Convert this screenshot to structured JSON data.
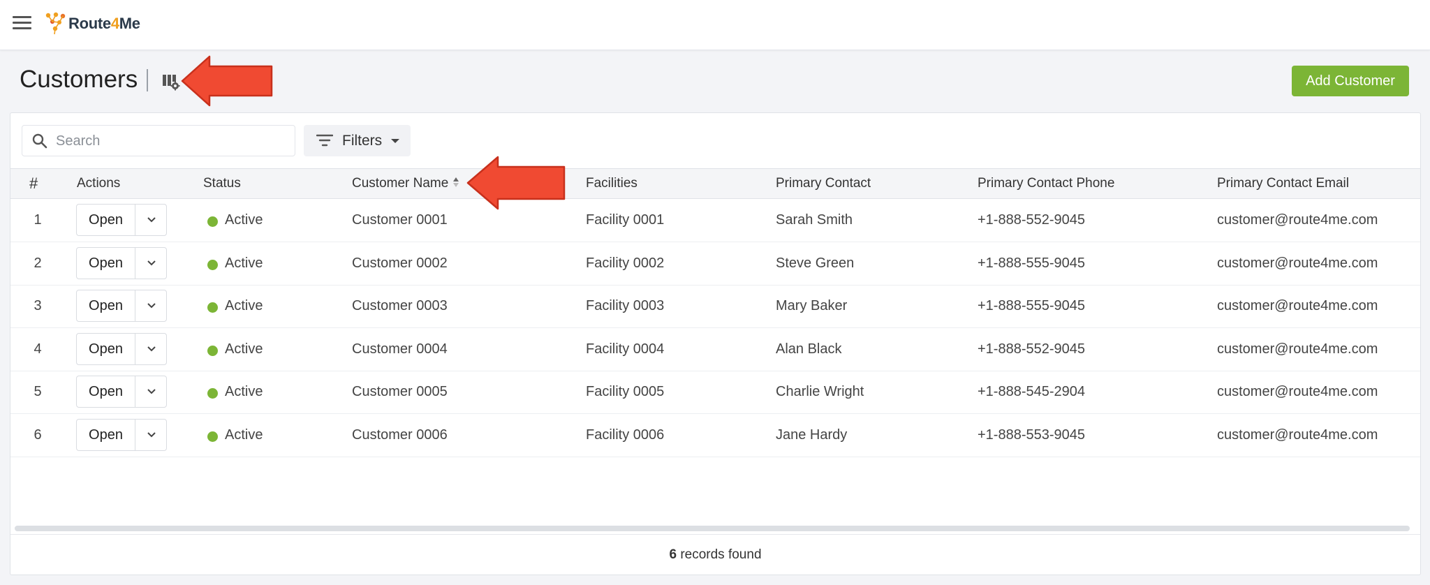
{
  "app": {
    "logo_prefix": "Route",
    "logo_four": "4",
    "logo_suffix": "Me"
  },
  "page": {
    "title": "Customers",
    "add_button": "Add Customer"
  },
  "toolbar": {
    "search_placeholder": "Search",
    "filters_label": "Filters"
  },
  "table": {
    "columns": [
      "#",
      "Actions",
      "Status",
      "Customer Name",
      "Facilities",
      "Primary Contact",
      "Primary Contact Phone",
      "Primary Contact Email"
    ],
    "rows": [
      {
        "num": "1",
        "action": "Open",
        "status": "Active",
        "name": "Customer 0001",
        "facility": "Facility 0001",
        "contact": "Sarah Smith",
        "phone": "+1-888-552-9045",
        "email": "customer@route4me.com"
      },
      {
        "num": "2",
        "action": "Open",
        "status": "Active",
        "name": "Customer 0002",
        "facility": "Facility 0002",
        "contact": "Steve Green",
        "phone": "+1-888-555-9045",
        "email": "customer@route4me.com"
      },
      {
        "num": "3",
        "action": "Open",
        "status": "Active",
        "name": "Customer 0003",
        "facility": "Facility 0003",
        "contact": "Mary Baker",
        "phone": "+1-888-555-9045",
        "email": "customer@route4me.com"
      },
      {
        "num": "4",
        "action": "Open",
        "status": "Active",
        "name": "Customer 0004",
        "facility": "Facility 0004",
        "contact": "Alan Black",
        "phone": "+1-888-552-9045",
        "email": "customer@route4me.com"
      },
      {
        "num": "5",
        "action": "Open",
        "status": "Active",
        "name": "Customer 0005",
        "facility": "Facility 0005",
        "contact": "Charlie Wright",
        "phone": "+1-888-545-2904",
        "email": "customer@route4me.com"
      },
      {
        "num": "6",
        "action": "Open",
        "status": "Active",
        "name": "Customer 0006",
        "facility": "Facility 0006",
        "contact": "Jane Hardy",
        "phone": "+1-888-553-9045",
        "email": "customer@route4me.com"
      }
    ]
  },
  "footer": {
    "count": "6",
    "suffix": " records found"
  },
  "icons": {
    "menu": "hamburger-icon",
    "logo": "route4me-logo-icon",
    "column_settings": "column-settings-icon",
    "search": "search-icon",
    "filter": "filter-icon",
    "sort": "sort-icon",
    "dropdown": "chevron-down-icon",
    "annotation": "red-arrow-icon"
  },
  "colors": {
    "accent_green": "#7cb536",
    "status_active": "#7cb536",
    "annotation_red": "#f04a32",
    "logo_orange": "#f0a020"
  }
}
